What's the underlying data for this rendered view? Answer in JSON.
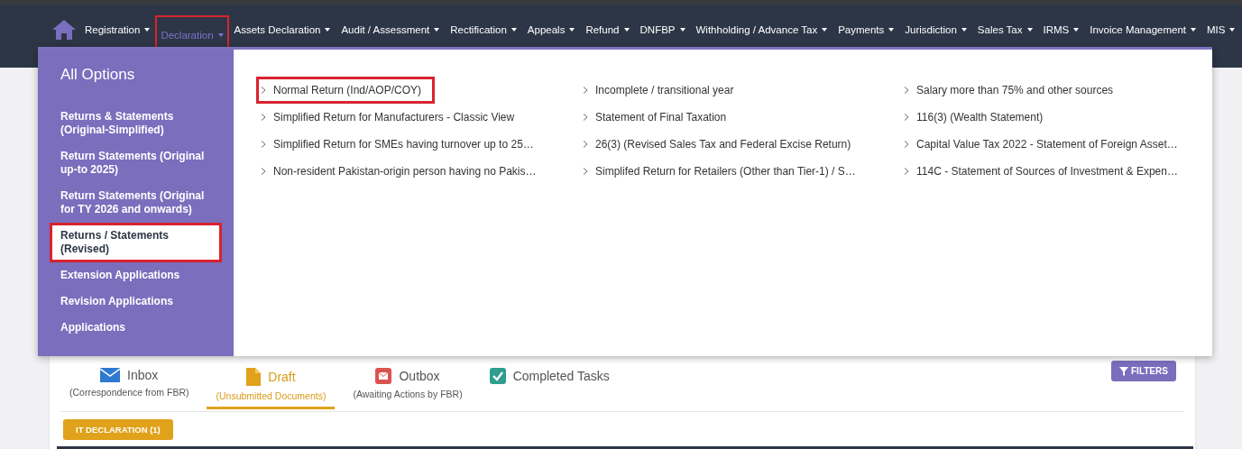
{
  "nav": {
    "items": [
      {
        "label": "Registration",
        "selected": false
      },
      {
        "label": "Declaration",
        "selected": true
      },
      {
        "label": "Assets Declaration",
        "selected": false
      },
      {
        "label": "Audit / Assessment",
        "selected": false
      },
      {
        "label": "Rectification",
        "selected": false
      },
      {
        "label": "Appeals",
        "selected": false
      },
      {
        "label": "Refund",
        "selected": false
      },
      {
        "label": "DNFBP",
        "selected": false
      },
      {
        "label": "Withholding / Advance Tax",
        "selected": false
      },
      {
        "label": "Payments",
        "selected": false
      },
      {
        "label": "Jurisdiction",
        "selected": false
      },
      {
        "label": "Sales Tax",
        "selected": false
      },
      {
        "label": "IRMS",
        "selected": false
      },
      {
        "label": "Invoice Management",
        "selected": false
      },
      {
        "label": "MIS",
        "selected": false
      }
    ]
  },
  "mega_menu": {
    "title": "All Options",
    "sidebar": {
      "items": [
        {
          "label": "Returns & Statements (Original-Simplified)",
          "selected": false
        },
        {
          "label": "Return Statements (Original up-to 2025)",
          "selected": false
        },
        {
          "label": "Return Statements (Original for TY 2026 and onwards)",
          "selected": false
        },
        {
          "label": "Returns / Statements (Revised)",
          "selected": true
        },
        {
          "label": "Extension Applications",
          "selected": false
        },
        {
          "label": "Revision Applications",
          "selected": false
        },
        {
          "label": "Applications",
          "selected": false
        }
      ]
    },
    "options": [
      {
        "label": "Normal Return (Ind/AOP/COY)",
        "highlighted": true
      },
      {
        "label": "Incomplete / transitional year",
        "highlighted": false
      },
      {
        "label": "Salary more than 75% and other sources",
        "highlighted": false
      },
      {
        "label": "Simplified Return for Manufacturers - Classic View",
        "highlighted": false
      },
      {
        "label": "Statement of Final Taxation",
        "highlighted": false
      },
      {
        "label": "116(3) (Wealth Statement)",
        "highlighted": false
      },
      {
        "label": "Simplified Return for SMEs having turnover up to 25…",
        "highlighted": false
      },
      {
        "label": "26(3) (Revised Sales Tax and Federal Excise Return)",
        "highlighted": false
      },
      {
        "label": "Capital Value Tax 2022 - Statement of Foreign Asset…",
        "highlighted": false
      },
      {
        "label": "Non-resident Pakistan-origin person having no Pakis…",
        "highlighted": false
      },
      {
        "label": "Simplifed Return for Retailers (Other than Tier-1) / S…",
        "highlighted": false
      },
      {
        "label": "114C - Statement of Sources of Investment & Expen…",
        "highlighted": false
      }
    ]
  },
  "mailbox": {
    "tabs": [
      {
        "kind": "envelope",
        "title": "Inbox",
        "subtitle": "(Correspondence from FBR)",
        "selected": false
      },
      {
        "kind": "file",
        "title": "Draft",
        "subtitle": "(Unsubmitted Documents)",
        "selected": true
      },
      {
        "kind": "envelope-box",
        "title": "Outbox",
        "subtitle": "(Awaiting Actions by FBR)",
        "selected": false
      },
      {
        "kind": "check-box",
        "title": "Completed Tasks",
        "selected": false
      }
    ],
    "filters_button": "FILTERS",
    "category_button": "IT DECLARATION (1)"
  }
}
